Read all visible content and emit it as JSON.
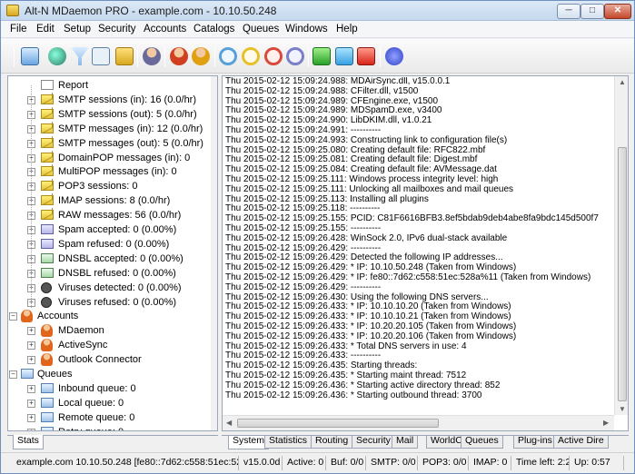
{
  "window": {
    "title": "Alt-N MDaemon PRO - example.com - 10.10.50.248",
    "min": "─",
    "max": "□",
    "close": "✕"
  },
  "menu": [
    "File",
    "Edit",
    "Setup",
    "Security",
    "Accounts",
    "Catalogs",
    "Queues",
    "Windows",
    "Help"
  ],
  "tree": [
    {
      "label": "Report",
      "icon": "report-icon",
      "level": 1
    },
    {
      "label": "SMTP sessions (in): 16  (0.0/hr)",
      "icon": "envelope-icon",
      "level": 1
    },
    {
      "label": "SMTP sessions (out): 5  (0.0/hr)",
      "icon": "envelope-icon",
      "level": 1
    },
    {
      "label": "SMTP messages (in): 12  (0.0/hr)",
      "icon": "envelope-icon",
      "level": 1
    },
    {
      "label": "SMTP messages (out): 5  (0.0/hr)",
      "icon": "envelope-icon",
      "level": 1
    },
    {
      "label": "DomainPOP messages (in): 0",
      "icon": "envelope-icon",
      "level": 1
    },
    {
      "label": "MultiPOP messages (in): 0",
      "icon": "envelope-icon",
      "level": 1
    },
    {
      "label": "POP3 sessions: 0",
      "icon": "envelope-icon",
      "level": 1
    },
    {
      "label": "IMAP sessions: 8  (0.0/hr)",
      "icon": "envelope-icon",
      "level": 1
    },
    {
      "label": "RAW messages: 56  (0.0/hr)",
      "icon": "envelope-icon",
      "level": 1
    },
    {
      "label": "Spam accepted: 0  (0.00%)",
      "icon": "spam-icon",
      "level": 1
    },
    {
      "label": "Spam refused: 0  (0.00%)",
      "icon": "spam-icon",
      "level": 1
    },
    {
      "label": "DNSBL accepted: 0  (0.00%)",
      "icon": "dnsbl-icon",
      "level": 1
    },
    {
      "label": "DNSBL refused: 0  (0.00%)",
      "icon": "dnsbl-icon",
      "level": 1
    },
    {
      "label": "Viruses detected: 0  (0.00%)",
      "icon": "virus-icon",
      "level": 1
    },
    {
      "label": "Viruses refused: 0  (0.00%)",
      "icon": "virus-icon",
      "level": 1
    },
    {
      "label": "Accounts",
      "icon": "accounts-icon",
      "level": 0
    },
    {
      "label": "MDaemon",
      "icon": "person-icon",
      "level": 1
    },
    {
      "label": "ActiveSync",
      "icon": "person-icon",
      "level": 1
    },
    {
      "label": "Outlook Connector",
      "icon": "person-icon",
      "level": 1
    },
    {
      "label": "Queues",
      "icon": "queues-icon",
      "level": 0
    },
    {
      "label": "Inbound queue: 0",
      "icon": "queue-envelope-icon",
      "level": 1
    },
    {
      "label": "Local queue: 0",
      "icon": "queue-envelope-icon",
      "level": 1
    },
    {
      "label": "Remote queue: 0",
      "icon": "queue-envelope-icon",
      "level": 1
    },
    {
      "label": "Retry queue: 0",
      "icon": "queue-envelope-icon",
      "level": 1
    }
  ],
  "log": [
    "Thu 2015-02-12 15:09:24.988: MDAirSync.dll, v15.0.0.1",
    "Thu 2015-02-12 15:09:24.988: CFilter.dll, v1500",
    "Thu 2015-02-12 15:09:24.989: CFEngine.exe, v1500",
    "Thu 2015-02-12 15:09:24.989: MDSpamD.exe, v3400",
    "Thu 2015-02-12 15:09:24.990: LibDKIM.dll, v1.0.21",
    "Thu 2015-02-12 15:09:24.991: ----------",
    "Thu 2015-02-12 15:09:24.993: Constructing link to configuration file(s)",
    "Thu 2015-02-12 15:09:25.080: Creating default file: RFC822.mbf",
    "Thu 2015-02-12 15:09:25.081: Creating default file: Digest.mbf",
    "Thu 2015-02-12 15:09:25.084: Creating default file: AVMessage.dat",
    "Thu 2015-02-12 15:09:25.111: Windows process integrity level: high",
    "Thu 2015-02-12 15:09:25.111: Unlocking all mailboxes and mail queues",
    "Thu 2015-02-12 15:09:25.113: Installing all plugins",
    "Thu 2015-02-12 15:09:25.118: ----------",
    "Thu 2015-02-12 15:09:25.155: PCID: C81F6616BFB3.8ef5bdab9deb4abe8fa9bdc145d500f7",
    "Thu 2015-02-12 15:09:25.155: ----------",
    "Thu 2015-02-12 15:09:26.428: WinSock 2.0, IPv6 dual-stack available",
    "Thu 2015-02-12 15:09:26.429: ----------",
    "Thu 2015-02-12 15:09:26.429: Detected the following IP addresses...",
    "Thu 2015-02-12 15:09:26.429: *  IP:  10.10.50.248  (Taken from Windows)",
    "Thu 2015-02-12 15:09:26.429: *  IP:  fe80::7d62:c558:51ec:528a%11  (Taken from Windows)",
    "Thu 2015-02-12 15:09:26.429: ----------",
    "Thu 2015-02-12 15:09:26.430: Using the following DNS servers...",
    "Thu 2015-02-12 15:09:26.433: *  IP:  10.10.10.20  (Taken from Windows)",
    "Thu 2015-02-12 15:09:26.433: *  IP:  10.10.10.21  (Taken from Windows)",
    "Thu 2015-02-12 15:09:26.433: *  IP:  10.20.20.105  (Taken from Windows)",
    "Thu 2015-02-12 15:09:26.433: *  IP:  10.20.20.106  (Taken from Windows)",
    "Thu 2015-02-12 15:09:26.433: *  Total DNS servers in use: 4",
    "Thu 2015-02-12 15:09:26.433: ----------",
    "Thu 2015-02-12 15:09:26.435: Starting threads:",
    "Thu 2015-02-12 15:09:26.435: *  Starting maint thread: 7512",
    "Thu 2015-02-12 15:09:26.436: *  Starting active directory thread: 852",
    "Thu 2015-02-12 15:09:26.436: *  Starting outbound thread: 3700"
  ],
  "left_tabs": [
    "Stats"
  ],
  "right_tabs": [
    "System",
    "Statistics",
    "Routing",
    "Security",
    "Mail",
    "WorldClient",
    "Queues",
    "Plug-ins",
    "Active Dire"
  ],
  "status": [
    "example.com  10.10.50.248  [fe80::7d62:c558:51ec:528a%",
    "v15.0.0d",
    "Active: 0",
    "Buf: 0/0",
    "SMTP: 0/0",
    "POP3: 0/0",
    "IMAP: 0",
    "Time left: 2:25",
    "Up: 0:57"
  ],
  "colors": {
    "accent": "#6a8cc9",
    "log_bg": "#ffffff"
  }
}
